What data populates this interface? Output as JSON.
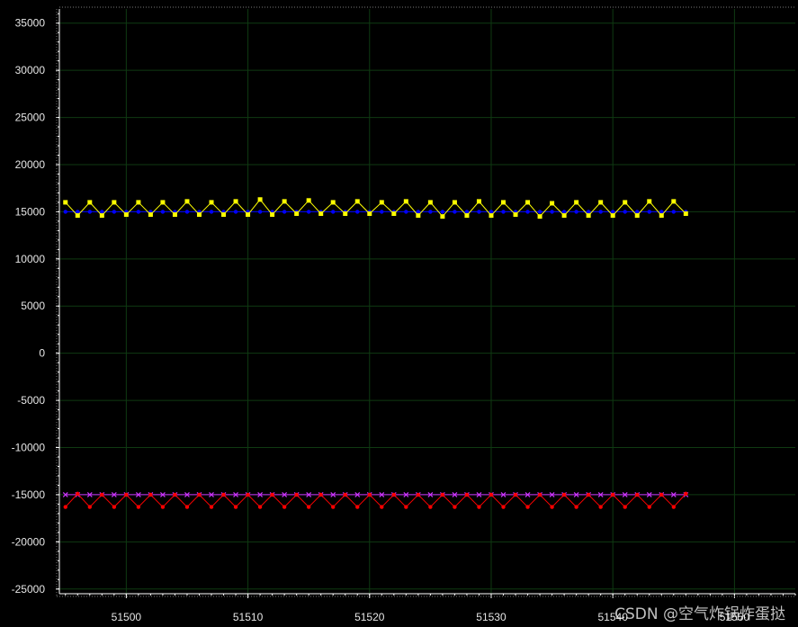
{
  "chart_data": {
    "type": "line",
    "xlim": [
      51494.5,
      51555
    ],
    "ylim": [
      -25500,
      36500
    ],
    "x_ticks": [
      51500,
      51510,
      51520,
      51530,
      51540,
      51550
    ],
    "y_ticks": [
      35000,
      30000,
      25000,
      20000,
      15000,
      10000,
      5000,
      0,
      -5000,
      -10000,
      -15000,
      -20000,
      -25000
    ],
    "grid": true,
    "colors": {
      "background": "#000000",
      "grid": "#0f3a12",
      "axis": "#ffffff",
      "tick_label": "#e6e6e6"
    },
    "series": [
      {
        "color": "#0000ff",
        "marker": "dot",
        "x": [
          51495,
          51546
        ],
        "y": [
          15000,
          15000
        ]
      },
      {
        "color": "#ffff00",
        "marker": "square",
        "x": [
          51495,
          51496,
          51497,
          51498,
          51499,
          51500,
          51501,
          51502,
          51503,
          51504,
          51505,
          51506,
          51507,
          51508,
          51509,
          51510,
          51511,
          51512,
          51513,
          51514,
          51515,
          51516,
          51517,
          51518,
          51519,
          51520,
          51521,
          51522,
          51523,
          51524,
          51525,
          51526,
          51527,
          51528,
          51529,
          51530,
          51531,
          51532,
          51533,
          51534,
          51535,
          51536,
          51537,
          51538,
          51539,
          51540,
          51541,
          51542,
          51543,
          51544,
          51545,
          51546
        ],
        "y": [
          16000,
          14600,
          16000,
          14600,
          16000,
          14700,
          16000,
          14700,
          16000,
          14700,
          16100,
          14700,
          16000,
          14700,
          16100,
          14700,
          16300,
          14700,
          16100,
          14800,
          16200,
          14800,
          16000,
          14800,
          16100,
          14800,
          16000,
          14800,
          16100,
          14600,
          16000,
          14500,
          16000,
          14600,
          16100,
          14600,
          16000,
          14700,
          16000,
          14500,
          15900,
          14600,
          16000,
          14600,
          16000,
          14600,
          16000,
          14600,
          16100,
          14600,
          16100,
          14800
        ]
      },
      {
        "color": "#cc33ff",
        "marker": "x",
        "x": [
          51495,
          51546
        ],
        "y": [
          -15000,
          -15000
        ]
      },
      {
        "color": "#ff0000",
        "marker": "dot",
        "x": [
          51495,
          51496,
          51497,
          51498,
          51499,
          51500,
          51501,
          51502,
          51503,
          51504,
          51505,
          51506,
          51507,
          51508,
          51509,
          51510,
          51511,
          51512,
          51513,
          51514,
          51515,
          51516,
          51517,
          51518,
          51519,
          51520,
          51521,
          51522,
          51523,
          51524,
          51525,
          51526,
          51527,
          51528,
          51529,
          51530,
          51531,
          51532,
          51533,
          51534,
          51535,
          51536,
          51537,
          51538,
          51539,
          51540,
          51541,
          51542,
          51543,
          51544,
          51545,
          51546
        ],
        "y": [
          -16300,
          -14900,
          -16300,
          -15000,
          -16300,
          -15000,
          -16300,
          -15000,
          -16300,
          -15000,
          -16300,
          -15000,
          -16300,
          -15000,
          -16300,
          -15000,
          -16300,
          -15000,
          -16300,
          -15000,
          -16300,
          -15000,
          -16300,
          -15000,
          -16300,
          -15000,
          -16300,
          -15000,
          -16300,
          -15000,
          -16300,
          -15000,
          -16300,
          -15000,
          -16300,
          -15000,
          -16300,
          -15000,
          -16300,
          -15000,
          -16300,
          -15000,
          -16300,
          -15000,
          -16300,
          -15000,
          -16300,
          -15000,
          -16300,
          -15000,
          -16300,
          -14900
        ]
      }
    ]
  },
  "watermark": "CSDN @空气炸锅炸蛋挞"
}
